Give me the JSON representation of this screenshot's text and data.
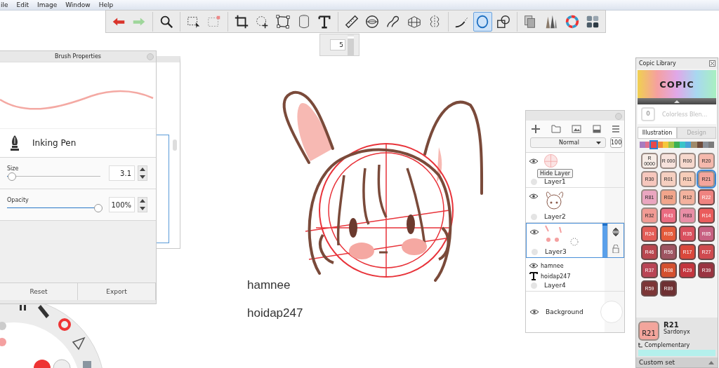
{
  "menu": [
    "ile",
    "Edit",
    "Image",
    "Window",
    "Help"
  ],
  "toolbar": {
    "tools": [
      {
        "kind": "undo",
        "selected": false,
        "separator_before": false
      },
      {
        "kind": "redo",
        "selected": false,
        "separator_before": false
      },
      {
        "kind": "zoom",
        "selected": false,
        "separator_before": true
      },
      {
        "kind": "select",
        "selected": false,
        "separator_before": true
      },
      {
        "kind": "deselect",
        "selected": false,
        "separator_before": false
      },
      {
        "kind": "crop",
        "selected": false,
        "separator_before": true
      },
      {
        "kind": "transform",
        "selected": false,
        "separator_before": false
      },
      {
        "kind": "distort",
        "selected": false,
        "separator_before": false
      },
      {
        "kind": "bucket",
        "selected": false,
        "separator_before": false
      },
      {
        "kind": "text",
        "selected": false,
        "separator_before": false
      },
      {
        "kind": "ruler",
        "selected": false,
        "separator_before": true
      },
      {
        "kind": "ellipse",
        "selected": false,
        "separator_before": false
      },
      {
        "kind": "curve",
        "selected": false,
        "separator_before": false
      },
      {
        "kind": "perspective",
        "selected": false,
        "separator_before": false
      },
      {
        "kind": "symmetry",
        "selected": false,
        "separator_before": false
      },
      {
        "kind": "stroke",
        "selected": false,
        "separator_before": true
      },
      {
        "kind": "circle",
        "selected": true,
        "separator_before": false
      },
      {
        "kind": "shapes",
        "selected": false,
        "separator_before": false
      },
      {
        "kind": "copy",
        "selected": false,
        "separator_before": true
      },
      {
        "kind": "brushes",
        "selected": false,
        "separator_before": false
      },
      {
        "kind": "color",
        "selected": false,
        "separator_before": false
      },
      {
        "kind": "palette",
        "selected": false,
        "separator_before": false
      }
    ],
    "size_value": "5",
    "size_slider": {
      "level": 0.9
    }
  },
  "brush_panel": {
    "title": "Brush Properties",
    "brush_name": "Inking Pen",
    "sliders": [
      {
        "label": "Size",
        "level": 0.05,
        "value": "3.1"
      },
      {
        "label": "Opacity",
        "level": 0.98,
        "value": "100%"
      }
    ],
    "buttons": [
      "Reset",
      "Export"
    ]
  },
  "canvas": {
    "texts": [
      "hamnee",
      "hoidap247"
    ]
  },
  "layers_panel": {
    "blend_mode": "Normal",
    "opacity": "100",
    "tooltip": "Hide Layer",
    "layers": [
      {
        "kind": "image",
        "name": "Layer1",
        "selected": false
      },
      {
        "kind": "image",
        "name": "Layer2",
        "selected": false
      },
      {
        "kind": "image",
        "name": "Layer3",
        "selected": true
      },
      {
        "kind": "group",
        "name": "Layer4",
        "selected": false,
        "children": [
          {
            "kind": "visible",
            "name": "hamnee"
          },
          {
            "kind": "text",
            "name": "hoidap247"
          }
        ]
      },
      {
        "kind": "background",
        "name": "Background",
        "selected": false
      }
    ]
  },
  "copic_panel": {
    "title": "Copic Library",
    "logo": "COPIC",
    "blender_code": "0",
    "blender_name": "Colorless Blen...",
    "tabs": [
      {
        "label": "Illustration",
        "selected": true
      },
      {
        "label": "Design",
        "selected": false
      }
    ],
    "hues": [
      {
        "color": "#a77cbf",
        "selected": false
      },
      {
        "color": "#e0708e",
        "selected": false
      },
      {
        "color": "#e8474a",
        "selected": true
      },
      {
        "color": "#f08a3a",
        "selected": false
      },
      {
        "color": "#f5c73b",
        "selected": false
      },
      {
        "color": "#9fc548",
        "selected": false
      },
      {
        "color": "#3bb055",
        "selected": false
      },
      {
        "color": "#3ac4c8",
        "selected": false
      },
      {
        "color": "#4aa0d6",
        "selected": false
      },
      {
        "color": "#a08a6a",
        "selected": false
      },
      {
        "color": "#6e4c3c",
        "selected": false
      },
      {
        "color": "#8a9098",
        "selected": false
      },
      {
        "color": "#7c7c7c",
        "selected": false
      }
    ],
    "swatches": [
      {
        "code": "R 0000",
        "color": "#f6ece6",
        "selected": false
      },
      {
        "code": "R 000",
        "color": "#f6e2dc",
        "selected": false
      },
      {
        "code": "R00",
        "color": "#f6d8cd",
        "selected": false
      },
      {
        "code": "R20",
        "color": "#f5b9ad",
        "selected": false
      },
      {
        "code": "R30",
        "color": "#f6c7bd",
        "selected": false
      },
      {
        "code": "R01",
        "color": "#f5cfc0",
        "selected": false
      },
      {
        "code": "R11",
        "color": "#f7cdb9",
        "selected": false
      },
      {
        "code": "R21",
        "color": "#f3a59c",
        "selected": true
      },
      {
        "code": "R81",
        "color": "#eaa6c0",
        "selected": false
      },
      {
        "code": "R02",
        "color": "#f2a58b",
        "selected": false
      },
      {
        "code": "R12",
        "color": "#f4b29e",
        "selected": false
      },
      {
        "code": "R22",
        "color": "#ef8380",
        "selected": false
      },
      {
        "code": "R32",
        "color": "#f19b94",
        "selected": false
      },
      {
        "code": "R43",
        "color": "#ea6b80",
        "selected": false
      },
      {
        "code": "R83",
        "color": "#e98ea6",
        "selected": false
      },
      {
        "code": "R14",
        "color": "#ea5c5c",
        "selected": false
      },
      {
        "code": "R24",
        "color": "#e35c57",
        "selected": false
      },
      {
        "code": "R05",
        "color": "#e45a3a",
        "selected": false
      },
      {
        "code": "R35",
        "color": "#d9505e",
        "selected": false
      },
      {
        "code": "R85",
        "color": "#c76082",
        "selected": false
      },
      {
        "code": "R46",
        "color": "#b9464f",
        "selected": false
      },
      {
        "code": "R56",
        "color": "#9e5461",
        "selected": false
      },
      {
        "code": "R17",
        "color": "#d9483b",
        "selected": false
      },
      {
        "code": "R27",
        "color": "#cf4a4f",
        "selected": false
      },
      {
        "code": "R37",
        "color": "#b94455",
        "selected": false
      },
      {
        "code": "R08",
        "color": "#d4502f",
        "selected": false
      },
      {
        "code": "R29",
        "color": "#c3363e",
        "selected": false
      },
      {
        "code": "R39",
        "color": "#9a3441",
        "selected": false
      },
      {
        "code": "R59",
        "color": "#7d3637",
        "selected": false
      },
      {
        "code": "R89",
        "color": "#6e3032",
        "selected": false
      }
    ],
    "current": {
      "swatch_code": "R21",
      "code": "R21",
      "name": "Sardonyx",
      "color": "#f3a59c"
    },
    "complementary_label": "Complementary",
    "custom_set_label": "Custom set"
  }
}
